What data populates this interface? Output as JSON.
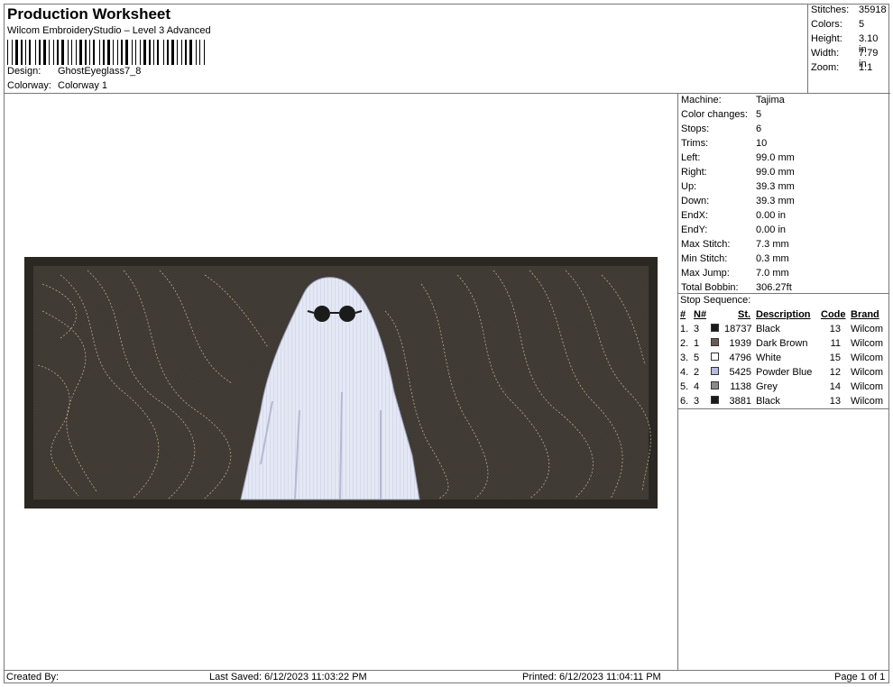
{
  "header": {
    "title": "Production Worksheet",
    "subtitle": "Wilcom EmbroideryStudio – Level 3 Advanced",
    "design_label": "Design:",
    "design_value": "GhostEyeglass7_8",
    "colorway_label": "Colorway:",
    "colorway_value": "Colorway 1"
  },
  "summary": [
    {
      "label": "Stitches:",
      "value": "35918"
    },
    {
      "label": "Colors:",
      "value": "5"
    },
    {
      "label": "Height:",
      "value": "3.10 in"
    },
    {
      "label": "Width:",
      "value": "7.79 in"
    },
    {
      "label": "Zoom:",
      "value": "1:1"
    }
  ],
  "machine_info": [
    {
      "label": "Machine:",
      "value": "Tajima"
    },
    {
      "label": "Color changes:",
      "value": "5"
    },
    {
      "label": "Stops:",
      "value": "6"
    },
    {
      "label": "Trims:",
      "value": "10"
    },
    {
      "label": "Left:",
      "value": "99.0 mm"
    },
    {
      "label": "Right:",
      "value": "99.0 mm"
    },
    {
      "label": "Up:",
      "value": "39.3 mm"
    },
    {
      "label": "Down:",
      "value": "39.3 mm"
    },
    {
      "label": "EndX:",
      "value": "0.00 in"
    },
    {
      "label": "EndY:",
      "value": "0.00 in"
    },
    {
      "label": "Max Stitch:",
      "value": "7.3 mm"
    },
    {
      "label": "Min Stitch:",
      "value": "0.3 mm"
    },
    {
      "label": "Max Jump:",
      "value": "7.0 mm"
    },
    {
      "label": "Total Bobbin:",
      "value": "306.27ft"
    }
  ],
  "stop_sequence": {
    "title": "Stop Sequence:",
    "headers": {
      "idx": "#",
      "n": "N#",
      "st": "St.",
      "desc": "Description",
      "code": "Code",
      "brand": "Brand"
    },
    "rows": [
      {
        "idx": "1.",
        "n": "3",
        "color": "#1a1a1a",
        "st": "18737",
        "desc": "Black",
        "code": "13",
        "brand": "Wilcom"
      },
      {
        "idx": "2.",
        "n": "1",
        "color": "#6b5a55",
        "st": "1939",
        "desc": "Dark Brown",
        "code": "11",
        "brand": "Wilcom"
      },
      {
        "idx": "3.",
        "n": "5",
        "color": "#ffffff",
        "st": "4796",
        "desc": "White",
        "code": "15",
        "brand": "Wilcom"
      },
      {
        "idx": "4.",
        "n": "2",
        "color": "#b7b9df",
        "st": "5425",
        "desc": "Powder Blue",
        "code": "12",
        "brand": "Wilcom"
      },
      {
        "idx": "5.",
        "n": "4",
        "color": "#8a8a8a",
        "st": "1138",
        "desc": "Grey",
        "code": "14",
        "brand": "Wilcom"
      },
      {
        "idx": "6.",
        "n": "3",
        "color": "#1a1a1a",
        "st": "3881",
        "desc": "Black",
        "code": "13",
        "brand": "Wilcom"
      }
    ]
  },
  "footer": {
    "created_by": "Created By:",
    "last_saved": "Last Saved: 6/12/2023 11:03:22 PM",
    "printed": "Printed: 6/12/2023 11:04:11 PM",
    "page": "Page 1 of 1"
  }
}
